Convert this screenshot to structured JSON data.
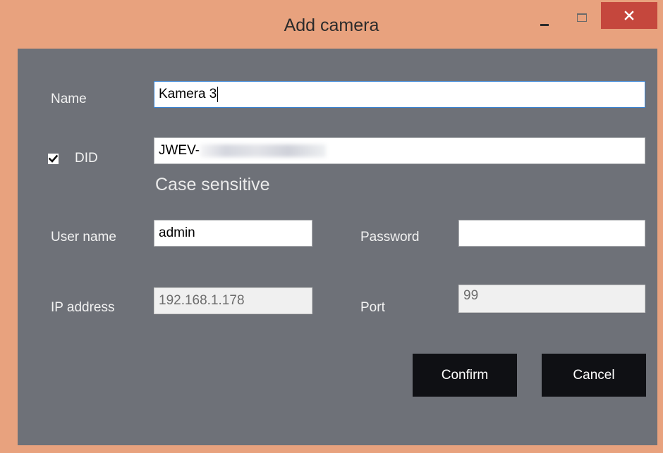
{
  "window": {
    "title": "Add camera"
  },
  "form": {
    "name": {
      "label": "Name",
      "value": "Kamera 3"
    },
    "did": {
      "label": "DID",
      "checked": true,
      "value": "JWEV-",
      "note": "Case sensitive"
    },
    "username": {
      "label": "User name",
      "value": "admin"
    },
    "password": {
      "label": "Password",
      "value": ""
    },
    "ip_address": {
      "label": "IP address",
      "value": "192.168.1.178"
    },
    "port": {
      "label": "Port",
      "value": "99"
    }
  },
  "buttons": {
    "confirm_label": "Confirm",
    "cancel_label": "Cancel"
  },
  "icons": {
    "minimize": "minimize-icon",
    "maximize": "maximize-icon",
    "close": "close-icon",
    "checkmark": "checkmark-icon"
  },
  "colors": {
    "frame": "#e8a27e",
    "client": "#6e7178",
    "close_button": "#c5473d",
    "button": "#0f1014",
    "focus_border": "#3b86d6"
  }
}
